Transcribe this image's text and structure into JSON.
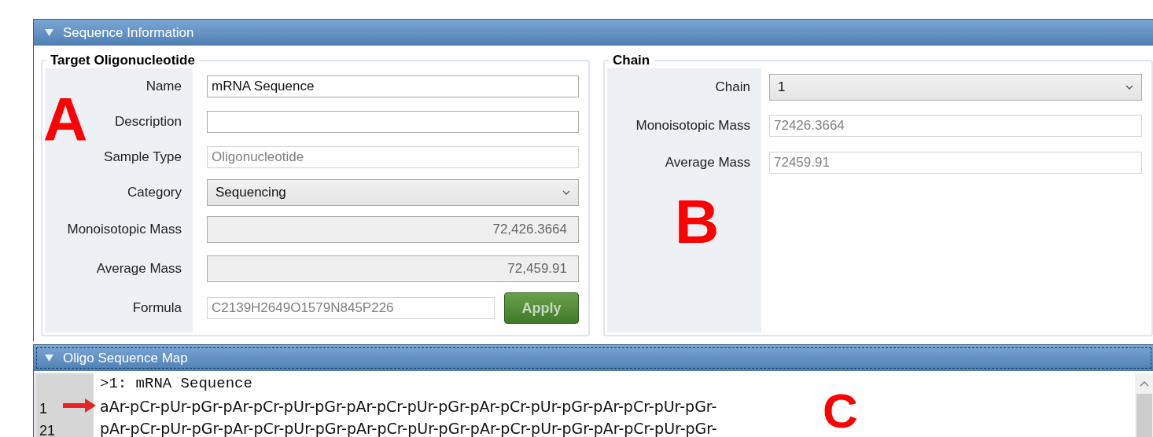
{
  "sequence_information": {
    "title": "Sequence Information",
    "expanded": true,
    "target_oligonucleotide": {
      "title": "Target Oligonucleotide",
      "fields": [
        {
          "label": "Name",
          "kind": "input",
          "value": "mRNA Sequence",
          "disabled": false
        },
        {
          "label": "Description",
          "kind": "input",
          "disabled": false
        },
        {
          "label": "Sample Type",
          "kind": "input",
          "value": "Oligonucleotide",
          "disabled": true
        },
        {
          "label": "Category",
          "kind": "dropdown",
          "value": "Sequencing",
          "disabled": false
        },
        {
          "label": "Monoisotopic Mass",
          "kind": "readonly",
          "value": "72,426.3664",
          "disabled": false
        },
        {
          "label": "Average Mass",
          "kind": "readonly",
          "value": "72,459.91",
          "disabled": false
        },
        {
          "label": "Formula",
          "kind": "input",
          "value": "C2139H2649O1579N845P226",
          "disabled": true,
          "button": "Apply"
        }
      ]
    },
    "chain": {
      "title": "Chain",
      "fields": [
        {
          "label": "Chain",
          "kind": "dropdown",
          "value": "1",
          "disabled": false
        },
        {
          "label": "Monoisotopic Mass",
          "kind": "input",
          "value": "72426.3664",
          "disabled": true
        },
        {
          "label": "Average Mass",
          "kind": "input",
          "value": "72459.91",
          "disabled": true
        }
      ]
    }
  },
  "oligo_sequence_map": {
    "title": "Oligo Sequence Map",
    "expanded": true,
    "lines": [
      {
        "kind": "header",
        "text": ">1: mRNA Sequence"
      },
      {
        "kind": "sequence",
        "number": "1",
        "text": "aAr-pCr-pUr-pGr-pAr-pCr-pUr-pGr-pAr-pCr-pUr-pGr-pAr-pCr-pUr-pGr-pAr-pCr-pUr-pGr-"
      },
      {
        "kind": "sequence",
        "number": "21",
        "text": "pAr-pCr-pUr-pGr-pAr-pCr-pUr-pGr-pAr-pCr-pUr-pGr-pAr-pCr-pUr-pGr-pAr-pCr-pUr-pGr-"
      }
    ]
  },
  "annotations": [
    {
      "kind": "letter",
      "text": "A"
    },
    {
      "kind": "letter",
      "text": "B"
    },
    {
      "kind": "letter",
      "text": "C"
    },
    {
      "kind": "arrow"
    }
  ]
}
